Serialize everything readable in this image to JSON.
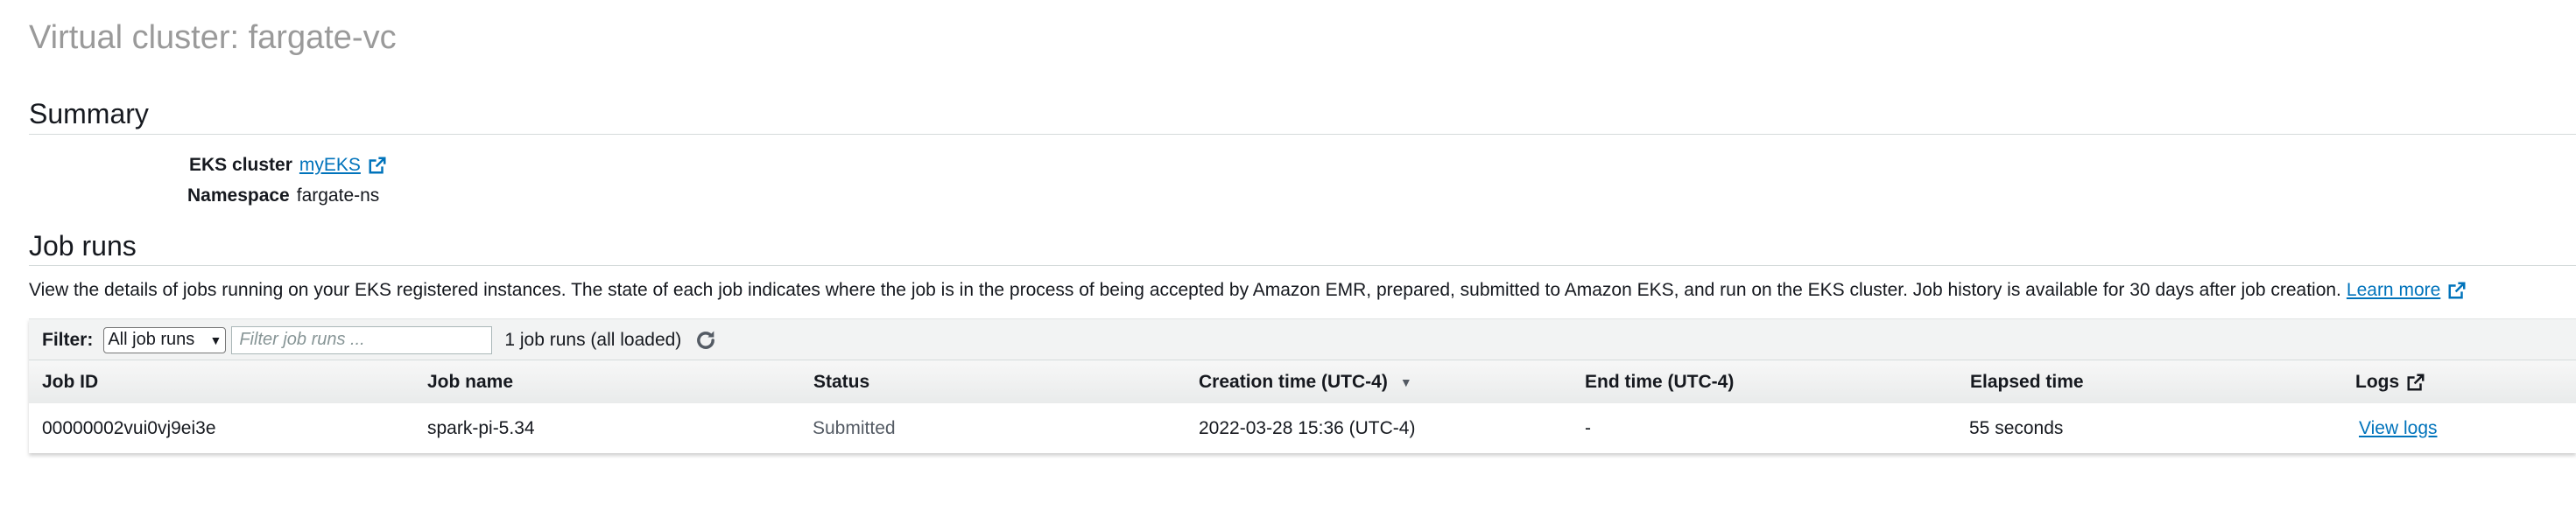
{
  "page": {
    "title": "Virtual cluster: fargate-vc"
  },
  "summary": {
    "heading": "Summary",
    "eks_cluster_label": "EKS cluster",
    "eks_cluster_value": "myEKS",
    "namespace_label": "Namespace",
    "namespace_value": "fargate-ns"
  },
  "job_runs": {
    "heading": "Job runs",
    "description": "View the details of jobs running on your EKS registered instances. The state of each job indicates where the job is in the process of being accepted by Amazon EMR, prepared, submitted to Amazon EKS, and run on the EKS cluster. Job history is available for 30 days after job creation.",
    "learn_more": "Learn more",
    "filter": {
      "label": "Filter:",
      "select_value": "All job runs",
      "input_placeholder": "Filter job runs ...",
      "count_text": "1 job runs (all loaded)"
    },
    "columns": [
      "Job ID",
      "Job name",
      "Status",
      "Creation time (UTC-4)",
      "End time (UTC-4)",
      "Elapsed time",
      "Logs"
    ],
    "rows": [
      {
        "job_id": "00000002vui0vj9ei3e",
        "job_name": "spark-pi-5.34",
        "status": "Submitted",
        "creation_time": "2022-03-28 15:36 (UTC-4)",
        "end_time": "-",
        "elapsed_time": "55 seconds",
        "logs": "View logs"
      }
    ]
  },
  "icons": {
    "external_link": "external-link-icon",
    "refresh": "refresh-icon",
    "sort": "sort-down-icon",
    "dropdown": "chevron-down-icon"
  },
  "colors": {
    "link": "#0073bb",
    "title_gray": "#9a9a9a",
    "header_bg": "#f2f3f3"
  }
}
